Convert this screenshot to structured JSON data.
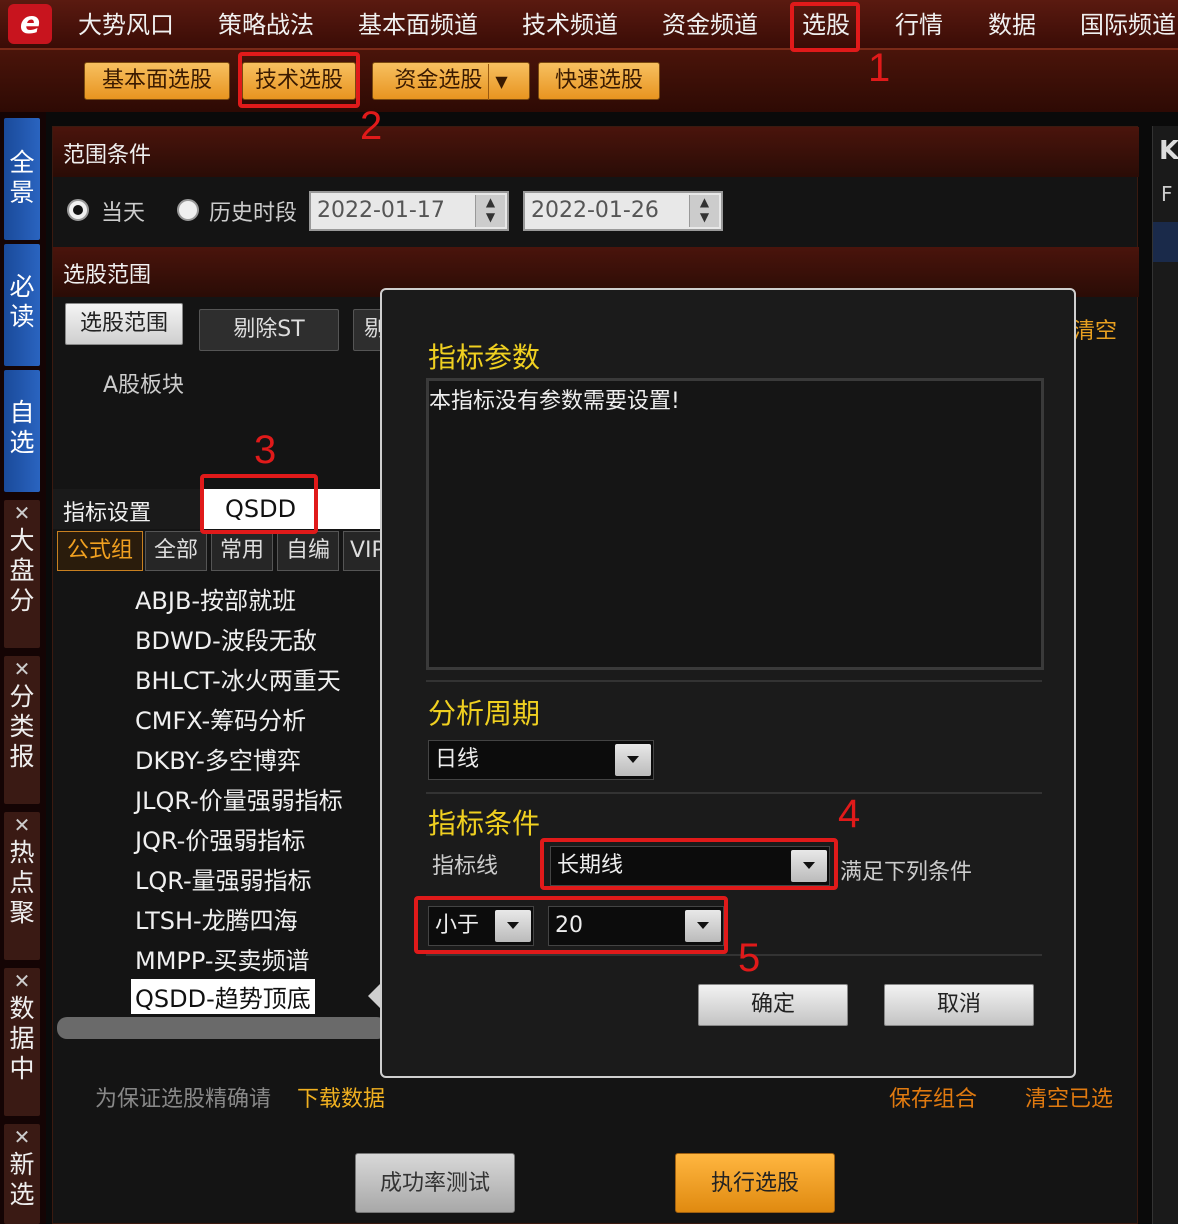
{
  "topnav": {
    "logo": "e",
    "items": [
      "大势风口",
      "策略战法",
      "基本面频道",
      "技术频道",
      "资金频道",
      "选股",
      "行情",
      "数据",
      "国际频道"
    ]
  },
  "subbar": {
    "buttons": [
      "基本面选股",
      "技术选股",
      "资金选股",
      "快速选股"
    ],
    "dropdown_caret": "▼"
  },
  "left_tabs": {
    "blue": [
      "全景",
      "必读",
      "自选"
    ],
    "closable": [
      "大盘分",
      "分类报",
      "热点聚",
      "数据中",
      "新选"
    ],
    "close_glyph": "✕"
  },
  "range": {
    "title": "范围条件",
    "today_label": "当天",
    "history_label": "历史时段",
    "start_date": "2022-01-17",
    "end_date": "2022-01-26",
    "today_selected": true
  },
  "scope": {
    "title": "选股范围",
    "buttons": [
      "选股范围",
      "剔除ST",
      "剔"
    ],
    "clear": "清空",
    "item": "A股板块"
  },
  "indicator": {
    "title": "指标设置",
    "search_value": "QSDD",
    "tabs": [
      "公式组",
      "全部",
      "常用",
      "自编",
      "VIP"
    ],
    "formulas": [
      "ABJB-按部就班",
      "BDWD-波段无敌",
      "BHLCT-冰火两重天",
      "CMFX-筹码分析",
      "DKBY-多空博弈",
      "JLQR-价量强弱指标",
      "JQR-价强弱指标",
      "LQR-量强弱指标",
      "LTSH-龙腾四海",
      "MMPP-买卖频谱",
      "QSDD-趋势顶底"
    ],
    "selected_formula": "QSDD-趋势顶底"
  },
  "footer": {
    "notice": "为保证选股精确请",
    "download": "下载数据",
    "save": "保存组合",
    "clear_selected": "清空已选",
    "test_button": "成功率测试",
    "run_button": "执行选股"
  },
  "dialog": {
    "params_title": "指标参数",
    "params_text": "本指标没有参数需要设置!",
    "period_title": "分析周期",
    "period_value": "日线",
    "cond_title": "指标条件",
    "line_label": "指标线",
    "line_value": "长期线",
    "satisfy_text": "满足下列条件",
    "operator_value": "小于",
    "threshold_value": "20",
    "ok_button": "确定",
    "cancel_button": "取消"
  },
  "annotations": [
    "1",
    "2",
    "3",
    "4",
    "5"
  ],
  "right_sliver": {
    "letter": "K",
    "char": "F"
  },
  "colors": {
    "accent_yellow": "#f0d020",
    "accent_orange": "#e8a020",
    "highlight_red": "#e01a1a",
    "tab_blue": "#2a64c0"
  }
}
